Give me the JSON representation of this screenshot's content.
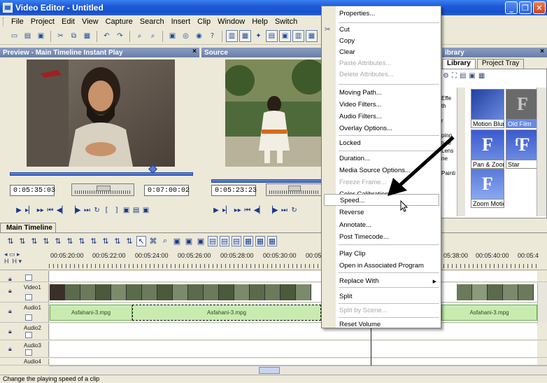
{
  "window": {
    "title": "Video Editor - Untitled",
    "minimize": "_",
    "restore": "❐",
    "close": "✕"
  },
  "menu": [
    "File",
    "Project",
    "Edit",
    "View",
    "Capture",
    "Search",
    "Insert",
    "Clip",
    "Window",
    "Help",
    "Switch"
  ],
  "preview": {
    "header": "Preview - Main Timeline Instant Play",
    "close": "×",
    "timecode_left": "0:05:35:03",
    "timecode_right": "0:07:00:02"
  },
  "source": {
    "header": "Source",
    "timecode_left": "0:05:23:23"
  },
  "library": {
    "header": "ibrary",
    "tabs": [
      "Library",
      "Project Tray"
    ],
    "close": "×",
    "side_text": [
      "Effe",
      "th",
      "r",
      "ping",
      "ture",
      "Lens",
      "ne",
      "Painti"
    ],
    "effects": [
      "Motion Blur",
      "Old Film",
      "Pan & Zoom",
      "Star",
      "Zoom Motio"
    ]
  },
  "timeline": {
    "tab": "Main Timeline",
    "ruler": [
      "00:05:20:00",
      "00:05:22:00",
      "00:05:24:00",
      "00:05:26:00",
      "00:05:28:00",
      "00:05:30:00",
      "00:05",
      "05:38:00",
      "00:05:40:00",
      "00:05:4"
    ],
    "tracks": [
      "Video1",
      "Audio1",
      "Audio2",
      "Audio3",
      "Audio4"
    ],
    "clip_label": "Asfahani-3.mpg"
  },
  "status": "Change the playing speed of a clip",
  "context_menu": {
    "items": [
      {
        "label": "Properties...",
        "disabled": false
      },
      {
        "label": "Cut",
        "disabled": false,
        "icon": "✂"
      },
      {
        "label": "Copy",
        "disabled": false
      },
      {
        "label": "Clear",
        "disabled": false
      },
      {
        "label": "Paste Attributes...",
        "disabled": true
      },
      {
        "label": "Delete Attributes...",
        "disabled": true
      },
      {
        "label": "Moving Path...",
        "disabled": false
      },
      {
        "label": "Video Filters...",
        "disabled": false
      },
      {
        "label": "Audio Filters...",
        "disabled": false
      },
      {
        "label": "Overlay Options...",
        "disabled": false
      },
      {
        "label": "Locked",
        "disabled": false
      },
      {
        "label": "Duration...",
        "disabled": false
      },
      {
        "label": "Media Source Options...",
        "disabled": false
      },
      {
        "label": "Freeze Frame...",
        "disabled": true
      },
      {
        "label": "Color Calibration...",
        "disabled": false
      },
      {
        "label": "Speed...",
        "disabled": false,
        "highlighted": true
      },
      {
        "label": "Reverse",
        "disabled": false
      },
      {
        "label": "Annotate...",
        "disabled": false
      },
      {
        "label": "Post Timecode...",
        "disabled": false
      },
      {
        "label": "Play Clip",
        "disabled": false
      },
      {
        "label": "Open in Associated Program",
        "disabled": false
      },
      {
        "label": "Replace With",
        "disabled": false,
        "submenu": true
      },
      {
        "label": "Split",
        "disabled": false
      },
      {
        "label": "Split by Scene...",
        "disabled": true
      },
      {
        "label": "Reset Volume",
        "disabled": false
      }
    ]
  },
  "colors": {
    "titlebar": "#1f5bd8",
    "panel_header": "#6a7fa8",
    "audio_clip": "#c8ecb0"
  }
}
